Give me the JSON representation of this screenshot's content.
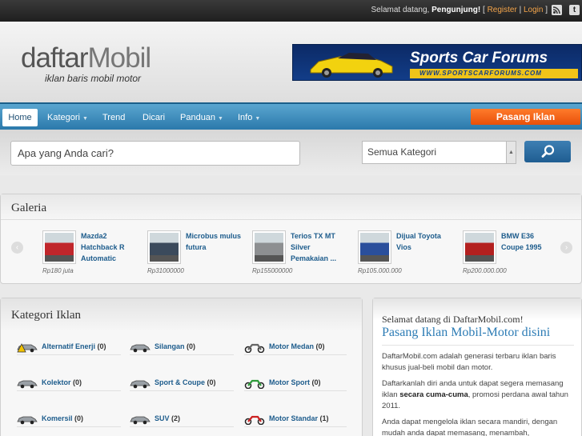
{
  "topbar": {
    "greeting": "Selamat datang,",
    "user": "Pengunjung!",
    "register": "Register",
    "login": "Login",
    "icons": [
      "rss-icon",
      "tumblr-icon"
    ]
  },
  "header": {
    "logo_part1": "daftar",
    "logo_part2": "Mobil",
    "tagline": "iklan baris mobil motor",
    "banner_title": "Sports Car Forums",
    "banner_url": "WWW.SPORTSCARFORUMS.COM"
  },
  "nav": {
    "items": [
      {
        "label": "Home",
        "active": true
      },
      {
        "label": "Kategori",
        "dropdown": true
      },
      {
        "label": "Trend"
      },
      {
        "label": "Dicari"
      },
      {
        "label": "Panduan",
        "dropdown": true
      },
      {
        "label": "Info",
        "dropdown": true
      }
    ],
    "cta": "Pasang Iklan"
  },
  "search": {
    "placeholder": "Apa yang Anda cari?",
    "category": "Semua Kategori"
  },
  "galeria": {
    "title": "Galeria",
    "items": [
      {
        "title": "Mazda2 Hatchback R Automatic",
        "price": "Rp180 juta",
        "color": "#c0262b"
      },
      {
        "title": "Microbus mulus futura",
        "price": "Rp31000000",
        "color": "#3b4a5c"
      },
      {
        "title": "Terios TX MT Silver Pemakaian ...",
        "price": "Rp155000000",
        "color": "#8d8f91"
      },
      {
        "title": "Dijual Toyota Vios",
        "price": "Rp105.000.000",
        "color": "#2a4f9c"
      },
      {
        "title": "BMW E36 Coupe 1995",
        "price": "Rp200.000.000",
        "color": "#b3201f"
      }
    ]
  },
  "kategori": {
    "title": "Kategori Iklan",
    "items": [
      {
        "label": "Alternatif Enerji",
        "count": "(0)"
      },
      {
        "label": "Silangan",
        "count": "(0)"
      },
      {
        "label": "Motor Medan",
        "count": "(0)"
      },
      {
        "label": "Kolektor",
        "count": "(0)"
      },
      {
        "label": "Sport & Coupe",
        "count": "(0)"
      },
      {
        "label": "Motor Sport",
        "count": "(0)"
      },
      {
        "label": "Komersil",
        "count": "(0)"
      },
      {
        "label": "SUV",
        "count": "(2)"
      },
      {
        "label": "Motor Standar",
        "count": "(1)"
      }
    ]
  },
  "welcome": {
    "line1": "Selamat datang di DaftarMobil.com!",
    "line2": "Pasang Iklan Mobil-Motor disini",
    "p1": "DaftarMobil.com adalah generasi terbaru iklan baris khusus jual-beli mobil dan motor.",
    "p2_a": "Daftarkanlah diri anda untuk dapat segera memasang iklan ",
    "p2_b": "secara cuma-cuma",
    "p2_c": ", promosi perdana awal tahun 2011.",
    "p3": "Anda dapat mengelola iklan secara mandiri, dengan mudah anda dapat memasang, menambah,"
  }
}
